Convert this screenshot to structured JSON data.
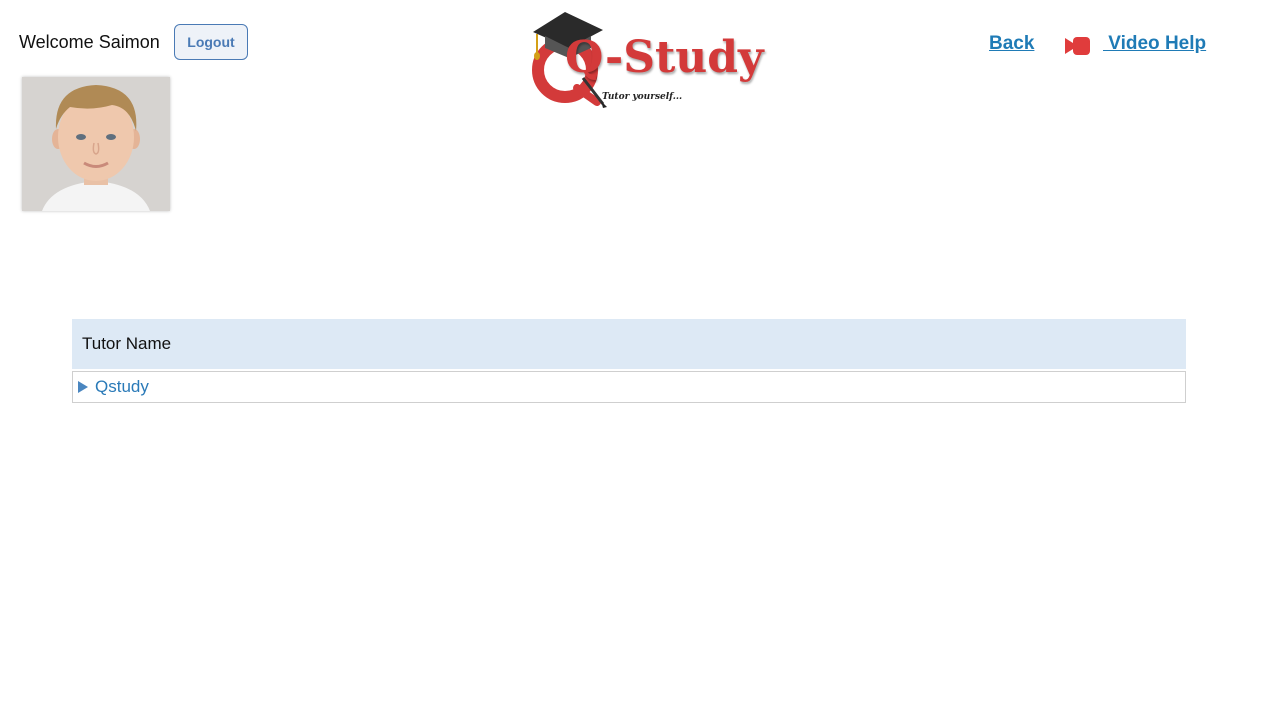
{
  "header": {
    "welcome_text": "Welcome Saimon",
    "logout_label": "Logout",
    "back_label": "Back",
    "video_help_label": " Video Help",
    "icons": [
      "video-camera-icon"
    ]
  },
  "logo": {
    "brand": "Q-Study",
    "tagline": "Tutor yourself..."
  },
  "profile": {
    "avatar": "user-photo"
  },
  "table": {
    "column_header": "Tutor Name",
    "rows": [
      {
        "label": "Qstudy",
        "icon": "expand-arrow-icon"
      }
    ]
  },
  "colors": {
    "link": "#1f7bb6",
    "brand_red": "#d33a3a",
    "header_bg": "#dde9f5"
  }
}
